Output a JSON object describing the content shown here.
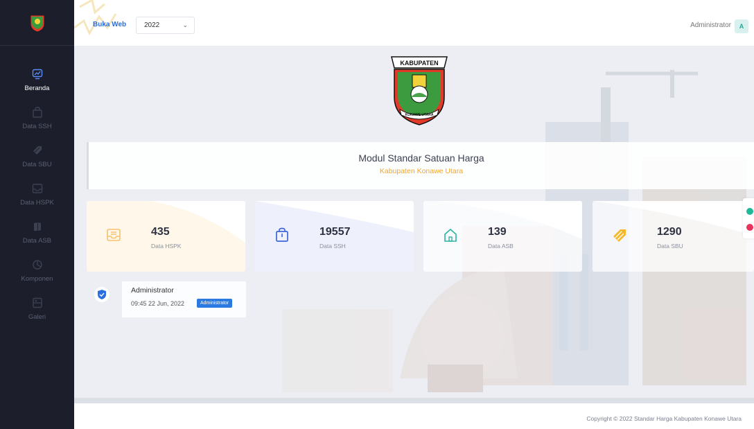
{
  "sidebar": {
    "items": [
      {
        "label": "Beranda",
        "icon": "monitor-chart-icon",
        "active": true
      },
      {
        "label": "Data SSH",
        "icon": "shopping-bag-icon",
        "active": false
      },
      {
        "label": "Data SBU",
        "icon": "tag-icon",
        "active": false
      },
      {
        "label": "Data HSPK",
        "icon": "inbox-icon",
        "active": false
      },
      {
        "label": "Data ASB",
        "icon": "book-icon",
        "active": false
      },
      {
        "label": "Komponen",
        "icon": "layers-icon",
        "active": false
      },
      {
        "label": "Galeri",
        "icon": "gallery-icon",
        "active": false
      }
    ]
  },
  "topbar": {
    "buka_web": "Buka Web",
    "year": "2022",
    "user_name": "Administrator",
    "avatar_letter": "A"
  },
  "emblem": {
    "banner_text": "KABUPATEN",
    "ribbon_text": "KONAWE UTARA"
  },
  "banner": {
    "title": "Modul Standar Satuan Harga",
    "subtitle": "Kabupaten Konawe Utara"
  },
  "cards": [
    {
      "value": "435",
      "label": "Data HSPK",
      "icon": "inbox-icon",
      "color": "#f5c16c"
    },
    {
      "value": "19557",
      "label": "Data SSH",
      "icon": "shopping-bag-icon",
      "color": "#3e64d8"
    },
    {
      "value": "139",
      "label": "Data ASB",
      "icon": "home-icon",
      "color": "#2bb3a4"
    },
    {
      "value": "1290",
      "label": "Data SBU",
      "icon": "tag-icon",
      "color": "#f5b829"
    }
  ],
  "user": {
    "name": "Administrator",
    "datetime": "09:45 22 Jun, 2022",
    "role": "Administrator"
  },
  "footer": {
    "copyright": "Copyright © 2022 Standar Harga Kabupaten Konawe Utara"
  },
  "colors": {
    "sidebar_bg": "#1c1f2b",
    "accent_blue": "#2a7ae2",
    "accent_orange": "#f5a623",
    "float_green": "#1fb89a",
    "float_red": "#e8335a"
  }
}
